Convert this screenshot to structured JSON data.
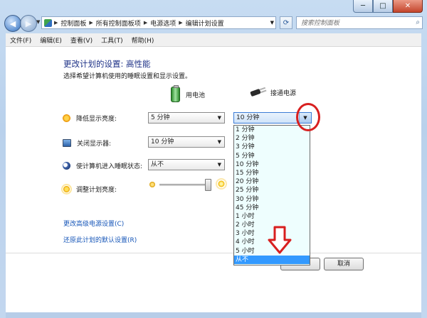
{
  "window": {
    "caption": {
      "minimize": "─",
      "maximize": "□",
      "close": "✕"
    }
  },
  "nav": {
    "back": "◀",
    "forward": "▶",
    "address_icon": "control-panel-icon",
    "breadcrumbs": [
      "控制面板",
      "所有控制面板项",
      "电源选项",
      "编辑计划设置"
    ],
    "search_placeholder": "搜索控制面板"
  },
  "menu": [
    "文件(F)",
    "编辑(E)",
    "查看(V)",
    "工具(T)",
    "帮助(H)"
  ],
  "page": {
    "title": "更改计划的设置: 高性能",
    "subtitle": "选择希望计算机使用的睡眠设置和显示设置。",
    "columns": {
      "battery": "用电池",
      "plugged": "接通电源"
    },
    "rows": [
      {
        "label": "降低显示亮度:",
        "battery_value": "5 分钟",
        "plugged_value": "10 分钟"
      },
      {
        "label": "关闭显示器:",
        "battery_value": "10 分钟"
      },
      {
        "label": "使计算机进入睡眠状态:",
        "battery_value": "从不"
      },
      {
        "label": "调整计划亮度:",
        "battery_brightness_percent": 100
      }
    ],
    "links": [
      "更改高级电源设置(C)",
      "还原此计划的默认设置(R)"
    ],
    "buttons": {
      "cancel": "取消"
    },
    "dropdown_options": [
      "1 分钟",
      "2 分钟",
      "3 分钟",
      "5 分钟",
      "10 分钟",
      "15 分钟",
      "20 分钟",
      "25 分钟",
      "30 分钟",
      "45 分钟",
      "1 小时",
      "2 小时",
      "3 小时",
      "4 小时",
      "5 小时",
      "从不"
    ],
    "dropdown_selected": "从不"
  },
  "colors": {
    "annotation": "#d81f1f",
    "link": "#1656b8",
    "title": "#1e3287",
    "highlight": "#3399ff"
  }
}
